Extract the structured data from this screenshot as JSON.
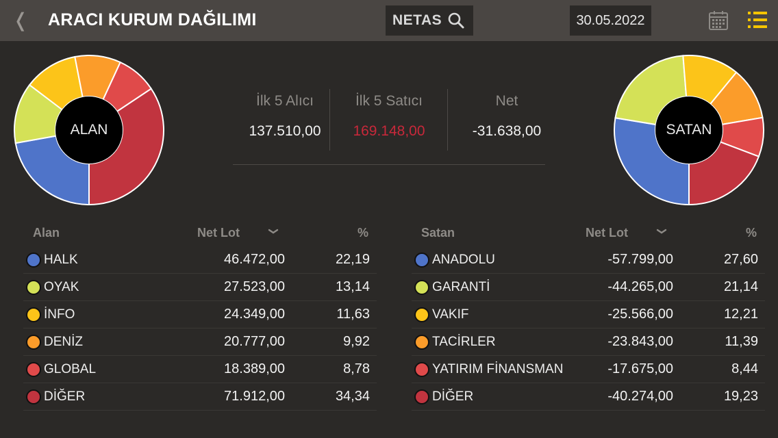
{
  "header": {
    "back_glyph": "❬",
    "title": "ARACI KURUM DAĞILIMI",
    "search_value": "NETAS",
    "date": "30.05.2022",
    "icons": [
      "chevron-left-icon",
      "search-icon",
      "calendar-icon",
      "list-icon"
    ],
    "accent_color": "#f5c400"
  },
  "donut_left": {
    "label": "ALAN",
    "slice_colors": [
      "#4f74c9",
      "#d4e157",
      "#fcc419",
      "#fb9c2a",
      "#e04a4a",
      "#c1343f"
    ]
  },
  "donut_right": {
    "label": "SATAN",
    "slice_colors": [
      "#4f74c9",
      "#d4e157",
      "#fcc419",
      "#fb9c2a",
      "#e04a4a",
      "#c1343f"
    ]
  },
  "summary": {
    "buyers_label": "İlk 5 Alıcı",
    "buyers_value": "137.510,00",
    "sellers_label": "İlk 5 Satıcı",
    "sellers_value": "169.148,00",
    "net_label": "Net",
    "net_value": "-31.638,00",
    "sellers_color": "#c8283a"
  },
  "buyers_table": {
    "col_name": "Alan",
    "col_lot": "Net Lot",
    "col_pct": "%",
    "rows": [
      {
        "name": "HALK",
        "lot": "46.472,00",
        "pct": "22,19",
        "pct_value": 22.19,
        "color": "#4f74c9"
      },
      {
        "name": "OYAK",
        "lot": "27.523,00",
        "pct": "13,14",
        "pct_value": 13.14,
        "color": "#d4e157"
      },
      {
        "name": "İNFO",
        "lot": "24.349,00",
        "pct": "11,63",
        "pct_value": 11.63,
        "color": "#fcc419"
      },
      {
        "name": "DENİZ",
        "lot": "20.777,00",
        "pct": "9,92",
        "pct_value": 9.92,
        "color": "#fb9c2a"
      },
      {
        "name": "GLOBAL",
        "lot": "18.389,00",
        "pct": "8,78",
        "pct_value": 8.78,
        "color": "#e04a4a"
      },
      {
        "name": "DİĞER",
        "lot": "71.912,00",
        "pct": "34,34",
        "pct_value": 34.34,
        "color": "#c1343f"
      }
    ]
  },
  "sellers_table": {
    "col_name": "Satan",
    "col_lot": "Net Lot",
    "col_pct": "%",
    "rows": [
      {
        "name": "ANADOLU",
        "lot": "-57.799,00",
        "pct": "27,60",
        "pct_value": 27.6,
        "color": "#4f74c9"
      },
      {
        "name": "GARANTİ",
        "lot": "-44.265,00",
        "pct": "21,14",
        "pct_value": 21.14,
        "color": "#d4e157"
      },
      {
        "name": "VAKIF",
        "lot": "-25.566,00",
        "pct": "12,21",
        "pct_value": 12.21,
        "color": "#fcc419"
      },
      {
        "name": "TACİRLER",
        "lot": "-23.843,00",
        "pct": "11,39",
        "pct_value": 11.39,
        "color": "#fb9c2a"
      },
      {
        "name": "YATIRIM FİNANSMAN",
        "lot": "-17.675,00",
        "pct": "8,44",
        "pct_value": 8.44,
        "color": "#e04a4a"
      },
      {
        "name": "DİĞER",
        "lot": "-40.274,00",
        "pct": "19,23",
        "pct_value": 19.23,
        "color": "#c1343f"
      }
    ]
  }
}
